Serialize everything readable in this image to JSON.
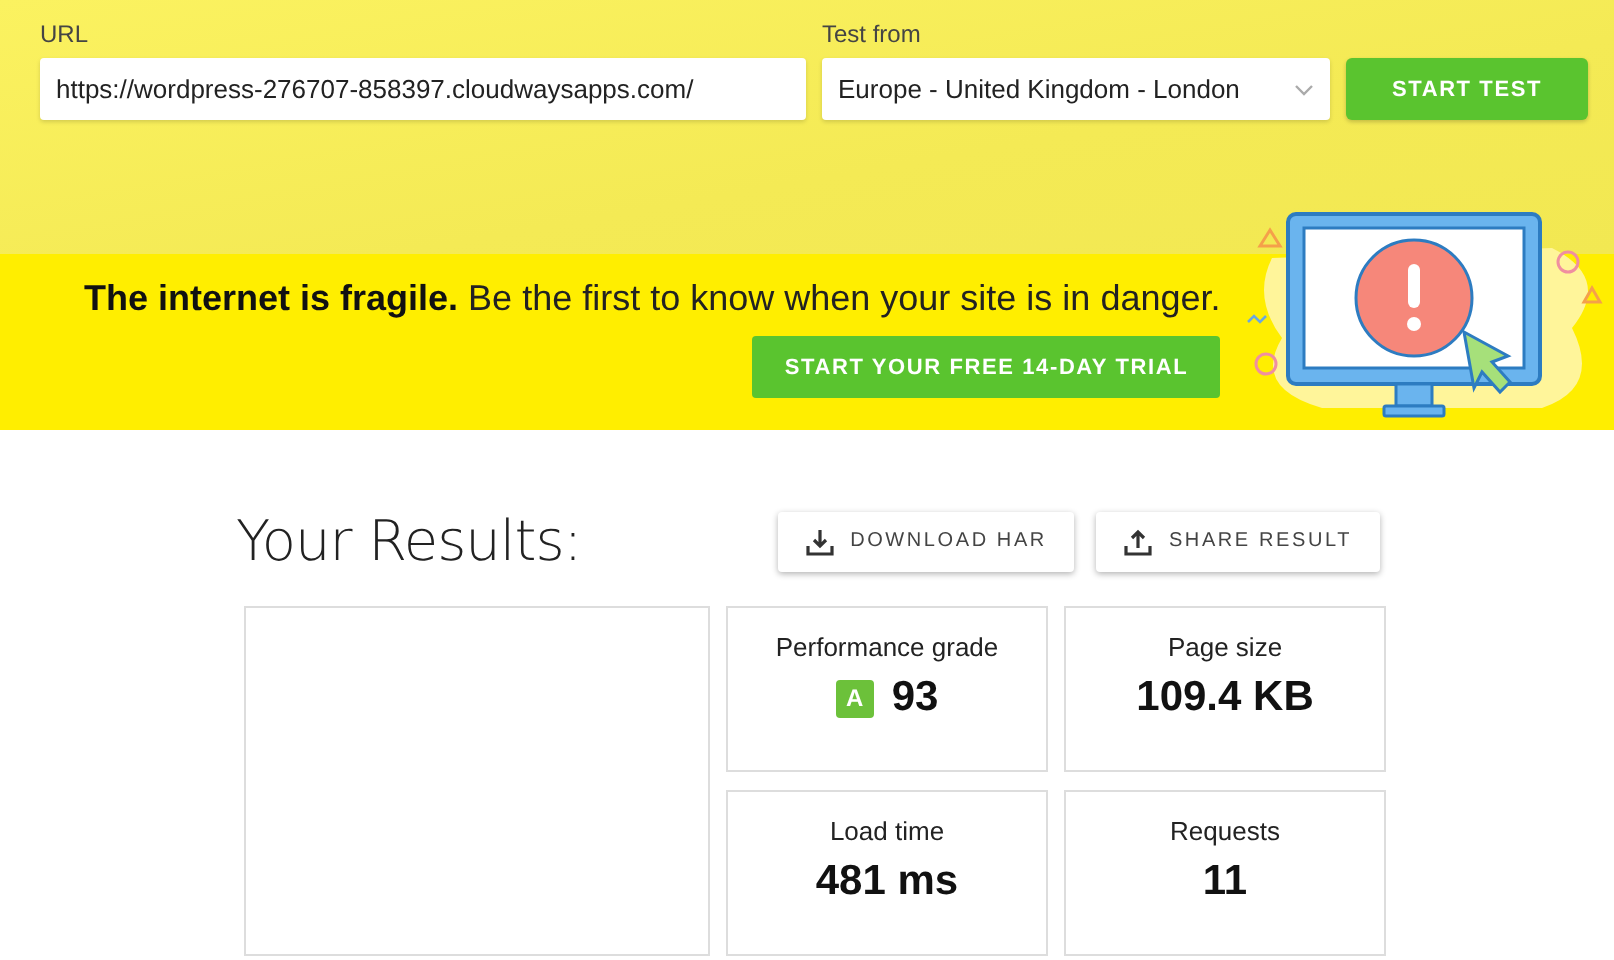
{
  "test_form": {
    "url_label": "URL",
    "url_value": "https://wordpress-276707-858397.cloudwaysapps.com/",
    "location_label": "Test from",
    "location_value": "Europe - United Kingdom - London",
    "start_button": "START TEST"
  },
  "banner": {
    "headline": "**The internet is fragile.** Be the first to know when your site is in danger.",
    "trial_button": "START YOUR FREE 14-DAY TRIAL"
  },
  "results": {
    "title": "Your Results:",
    "actions": [
      {
        "label": "DOWNLOAD HAR",
        "kind": "download"
      },
      {
        "label": "SHARE RESULT",
        "kind": "share"
      }
    ],
    "metrics": [
      {
        "label": "Performance grade",
        "grade": "A",
        "value": "93"
      },
      {
        "label": "Page size",
        "value": "109.4 KB"
      },
      {
        "label": "Load time",
        "value": "481 ms"
      },
      {
        "label": "Requests",
        "value": "11"
      }
    ]
  }
}
